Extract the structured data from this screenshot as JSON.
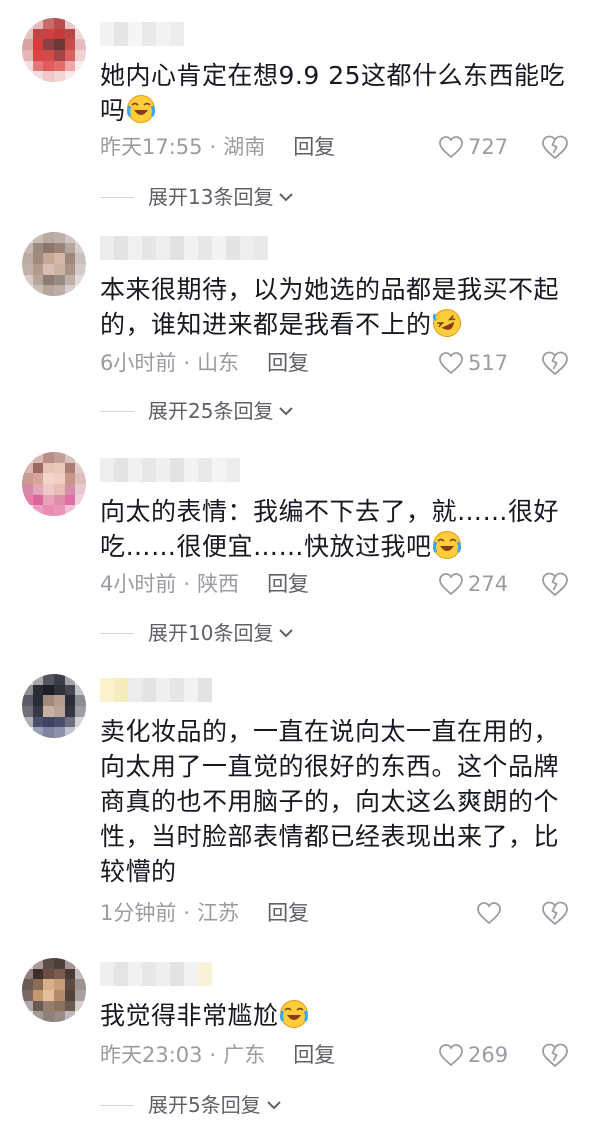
{
  "comments": [
    {
      "text": "她内心肯定在想9.9 25这都什么东西能吃吗",
      "emoji": "cry-laugh-emoji",
      "time": "昨天17:55",
      "location": "湖南",
      "reply_label": "回复",
      "likes": "727",
      "expand_label": "展开13条回复"
    },
    {
      "text": "本来很期待，以为她选的品都是我买不起的，谁知进来都是我看不上的",
      "emoji": "rofl-emoji",
      "time": "6小时前",
      "location": "山东",
      "reply_label": "回复",
      "likes": "517",
      "expand_label": "展开25条回复"
    },
    {
      "text": "向太的表情：我编不下去了，就……很好吃……很便宜……快放过我吧",
      "emoji": "cry-laugh-emoji",
      "time": "4小时前",
      "location": "陕西",
      "reply_label": "回复",
      "likes": "274",
      "expand_label": "展开10条回复"
    },
    {
      "text": "卖化妆品的，一直在说向太一直在用的，向太用了一直觉的很好的东西。这个品牌商真的也不用脑子的，向太这么爽朗的个性，当时脸部表情都已经表现出来了，比较懵的",
      "emoji": "",
      "time": "1分钟前",
      "location": "江苏",
      "reply_label": "回复",
      "likes": "",
      "expand_label": ""
    },
    {
      "text": "我觉得非常尴尬",
      "emoji": "cry-laugh-emoji",
      "time": "昨天23:03",
      "location": "广东",
      "reply_label": "回复",
      "likes": "269",
      "expand_label": "展开5条回复"
    }
  ],
  "separator": "·",
  "colors": {
    "text": "#161823",
    "meta": "#9b9ca3",
    "action": "#5e6068",
    "background": "#ffffff"
  },
  "icons": [
    "heart-icon",
    "dislike-heart-icon",
    "chevron-down-icon",
    "cry-laugh-emoji",
    "rofl-emoji"
  ]
}
